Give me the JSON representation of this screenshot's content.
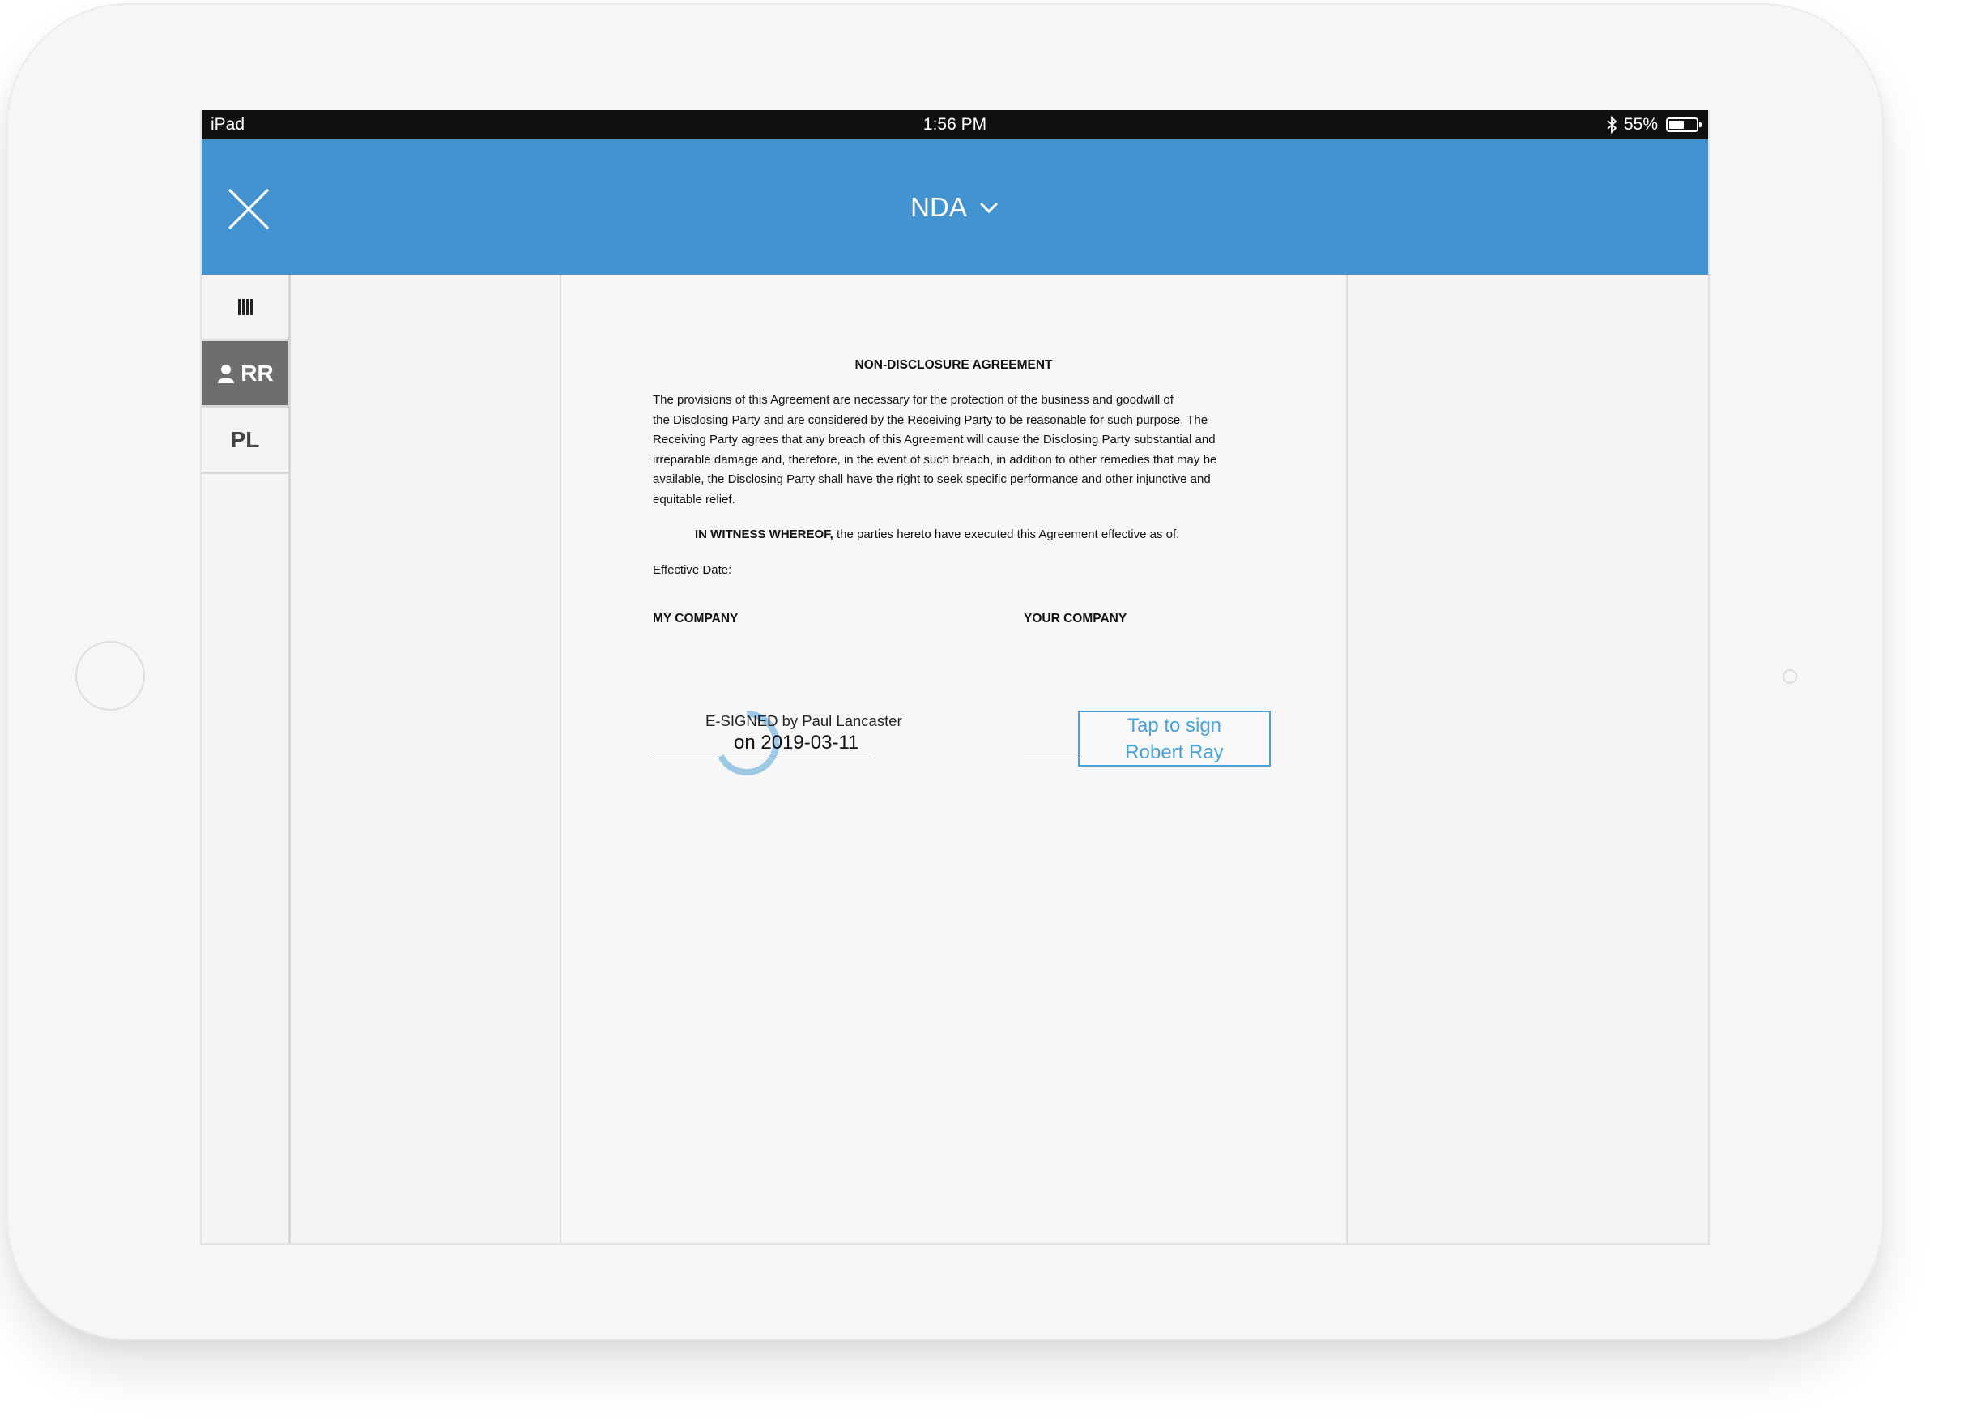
{
  "status_bar": {
    "device": "iPad",
    "time": "1:56 PM",
    "battery_percent": "55%",
    "battery_level": 0.55
  },
  "nav": {
    "close_icon": "close-icon",
    "title": "NDA",
    "title_icon": "chevron-down-icon",
    "accent_color": "#4393d0"
  },
  "sidebar": {
    "items": [
      {
        "label": "",
        "icon": "columns-icon"
      },
      {
        "label": "RR",
        "icon": "user-icon",
        "active": true
      },
      {
        "label": "PL",
        "icon": "",
        "active": false
      }
    ]
  },
  "document": {
    "title": "NON-DISCLOSURE AGREEMENT",
    "body_lines": [
      "The provisions of this Agreement are necessary for the protection of the business and goodwill of",
      "the Disclosing Party and are considered by the Receiving Party to be reasonable for such purpose. The",
      "Receiving Party agrees that any breach of this Agreement will cause the Disclosing Party substantial and",
      "irreparable damage and, therefore, in the event of such breach, in addition to other remedies that may be",
      "available, the Disclosing Party shall have the right to seek specific performance and other injunctive and",
      "equitable relief."
    ],
    "witness_bold": "IN WITNESS WHEREOF,",
    "witness_rest": " the parties hereto have executed this Agreement effective as of:",
    "effective_date_label": "Effective Date:",
    "party_mine": "MY COMPANY",
    "party_yours": "YOUR COMPANY",
    "esigned_by": "E-SIGNED by Paul Lancaster",
    "esigned_on": "on 2019-03-11",
    "tap_to_sign_line1": "Tap to sign",
    "tap_to_sign_line2": "Robert Ray",
    "sign_color": "#4aa3d8"
  }
}
